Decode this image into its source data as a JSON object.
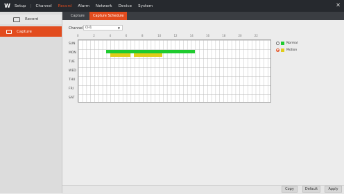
{
  "app": {
    "logo_glyph": "W"
  },
  "topnav": {
    "items": [
      "Setup",
      "Channel",
      "Record",
      "Alarm",
      "Network",
      "Device",
      "System"
    ],
    "active_index": 2,
    "close_glyph": "✕"
  },
  "sidebar": {
    "items": [
      {
        "label": "Record",
        "icon": "record-icon",
        "active": false
      },
      {
        "label": "Capture",
        "icon": "camera-icon",
        "active": true
      }
    ]
  },
  "tabs": [
    {
      "label": "Capture",
      "active": false
    },
    {
      "label": "Capture Schedule",
      "active": true
    }
  ],
  "channel": {
    "label": "Channel",
    "value": "CH1"
  },
  "schedule": {
    "hour_ticks": [
      "0",
      "2",
      "4",
      "6",
      "8",
      "10",
      "12",
      "14",
      "16",
      "18",
      "20",
      "22"
    ],
    "days": [
      "SUN",
      "MON",
      "TUE",
      "WED",
      "THU",
      "FRI",
      "SAT"
    ],
    "cells_per_day": 48,
    "segments": [
      {
        "day": "MON",
        "type": "Normal",
        "start_hour": 3.5,
        "end_hour": 14.5
      },
      {
        "day": "MON",
        "type": "Motion",
        "start_hour": 4.0,
        "end_hour": 6.5
      },
      {
        "day": "MON",
        "type": "Motion",
        "start_hour": 7.0,
        "end_hour": 10.5
      }
    ]
  },
  "legend": [
    {
      "label": "Normal",
      "color": "#1fcb2f",
      "selected": false
    },
    {
      "label": "Motion",
      "color": "#e0cc1a",
      "selected": true
    }
  ],
  "buttons": {
    "copy": "Copy",
    "default": "Default",
    "apply": "Apply"
  }
}
